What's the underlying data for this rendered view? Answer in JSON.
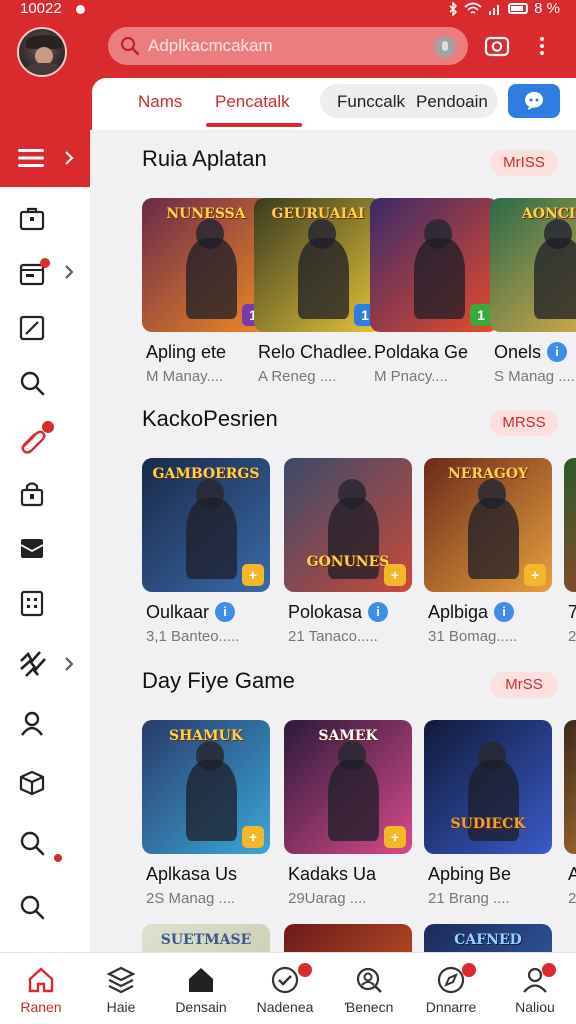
{
  "status_bar": {
    "time": "10022",
    "battery": "8 %"
  },
  "search": {
    "placeholder": "Adplkacmcakam"
  },
  "tabs": [
    {
      "label": "Nams"
    },
    {
      "label": "Pencatalk",
      "active": true
    }
  ],
  "filter_pill": {
    "left": "Funccalk",
    "right": "Pendoain"
  },
  "sidebar": {
    "icons": [
      "menu-icon",
      "bag-icon",
      "calendar-icon",
      "edit-icon",
      "search-icon",
      "clip-icon",
      "lock-icon",
      "inbox-icon",
      "grid-icon",
      "stats-icon",
      "user-icon",
      "box-icon",
      "search-icon",
      "search-icon"
    ]
  },
  "sections": [
    {
      "title": "Ruia Aplatan",
      "more": "MrISS",
      "cards": [
        {
          "logo": "NUNESSA",
          "name": "Apling ete",
          "sub": "M Manay....",
          "corner": "1",
          "colors": [
            "#6a2a4a",
            "#f08a24"
          ]
        },
        {
          "logo": "GEURUAIAI",
          "name": "Relo Chadlee.",
          "sub": "A Reneg ....",
          "corner": "1",
          "colors": [
            "#3a3a20",
            "#e6c63a"
          ]
        },
        {
          "logo": "",
          "name": "Poldaka Ge",
          "sub": "M Pnacy....",
          "corner": "1",
          "colors": [
            "#3a2a6a",
            "#e84c2a"
          ]
        },
        {
          "logo": "AONCIE",
          "name": "Onels",
          "sub": "S Manag ....",
          "corner": "",
          "colors": [
            "#2a6a4a",
            "#e8b04a"
          ],
          "info": true
        }
      ]
    },
    {
      "title": "KackoPesrien",
      "more": "MRSS",
      "cards": [
        {
          "logo": "GAMBOERGS",
          "name": "Oulkaar",
          "sub": "3,1 Banteo.....",
          "corner": "+",
          "colors": [
            "#1a2a4a",
            "#3a6aa8"
          ],
          "info": true
        },
        {
          "logo": "GONUNES",
          "name": "Polokasa",
          "sub": "21 Tanaco.....",
          "corner": "+",
          "colors": [
            "#3a4a6a",
            "#c84a3a"
          ],
          "info": true
        },
        {
          "logo": "NERAGOY",
          "name": "Aplbiga",
          "sub": "31 Bomag.....",
          "corner": "+",
          "colors": [
            "#6a2a1a",
            "#e8a040"
          ],
          "info": true
        },
        {
          "logo": "",
          "name": "7",
          "sub": "2",
          "corner": "",
          "colors": [
            "#2a5a2a",
            "#c8402a"
          ]
        }
      ]
    },
    {
      "title": "Day Fiye Game",
      "more": "MrSS",
      "cards": [
        {
          "logo": "SHAMUK",
          "name": "Aplkasa Us",
          "sub": "2S Manag ....",
          "corner": "+",
          "colors": [
            "#2a3a6a",
            "#3aa8d8"
          ]
        },
        {
          "logo": "SAMEK",
          "name": "Kadaks Ua",
          "sub": "29Uarag ....",
          "corner": "+",
          "colors": [
            "#2a1a3a",
            "#d84a8a"
          ]
        },
        {
          "logo": "SUDIECK",
          "name": "Apbing Be",
          "sub": "21 Brang ....",
          "corner": "",
          "colors": [
            "#101a3a",
            "#3a5ac8"
          ]
        },
        {
          "logo": "",
          "name": "A",
          "sub": "2",
          "corner": "",
          "colors": [
            "#3a2a1a",
            "#d88a3a"
          ]
        }
      ]
    },
    {
      "title": "",
      "more": "",
      "cards": [
        {
          "logo": "SUETMASE",
          "name": "",
          "sub": "",
          "corner": "",
          "colors": [
            "#e0e0d0",
            "#c0c8a8"
          ]
        },
        {
          "logo": "",
          "name": "",
          "sub": "",
          "corner": "",
          "colors": [
            "#6a1a1a",
            "#d8602a"
          ]
        },
        {
          "logo": "CAFNED",
          "name": "",
          "sub": "",
          "corner": "",
          "colors": [
            "#1a2a5a",
            "#3a6ab8"
          ]
        }
      ]
    }
  ],
  "bottom_nav": [
    {
      "label": "Ranen",
      "icon": "home-outline-icon",
      "active": true
    },
    {
      "label": "Haie",
      "icon": "layers-icon"
    },
    {
      "label": "Densain",
      "icon": "home-filled-icon"
    },
    {
      "label": "Nadenea",
      "icon": "check-circle-icon",
      "badge": true
    },
    {
      "label": "Ɓenecn",
      "icon": "search-user-icon"
    },
    {
      "label": "Dnnarre",
      "icon": "compass-icon",
      "badge": true
    },
    {
      "label": "Naliou",
      "icon": "profile-icon",
      "badge": true
    }
  ]
}
